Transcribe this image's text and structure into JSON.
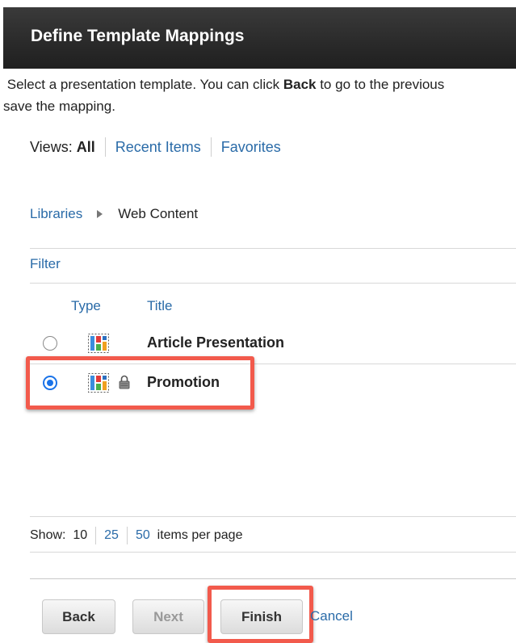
{
  "header": {
    "title": "Define Template Mappings"
  },
  "instructions": {
    "line1_prefix": "Select a presentation template. You can click ",
    "line1_bold": "Back",
    "line1_suffix": " to go to the previous",
    "line2": "save the mapping."
  },
  "views": {
    "label": "Views:",
    "current": "All",
    "links": [
      "Recent Items",
      "Favorites"
    ]
  },
  "breadcrumb": {
    "root": "Libraries",
    "current": "Web Content"
  },
  "filter": {
    "label": "Filter"
  },
  "table": {
    "columns": [
      "Type",
      "Title"
    ],
    "rows": [
      {
        "title": "Article Presentation",
        "selected": false,
        "locked": false,
        "icon": "presentation-template-icon"
      },
      {
        "title": "Promotion",
        "selected": true,
        "locked": true,
        "icon": "presentation-template-icon"
      }
    ]
  },
  "pagination": {
    "label": "Show:",
    "current": "10",
    "options": [
      "25",
      "50"
    ],
    "suffix": "items per page"
  },
  "buttons": {
    "back": "Back",
    "next": "Next",
    "finish": "Finish",
    "cancel": "Cancel"
  },
  "colors": {
    "link": "#2a6ba8",
    "highlight": "#f25a4c",
    "radio_selected": "#1a73e8",
    "header_bg": "#2b2b2b"
  }
}
